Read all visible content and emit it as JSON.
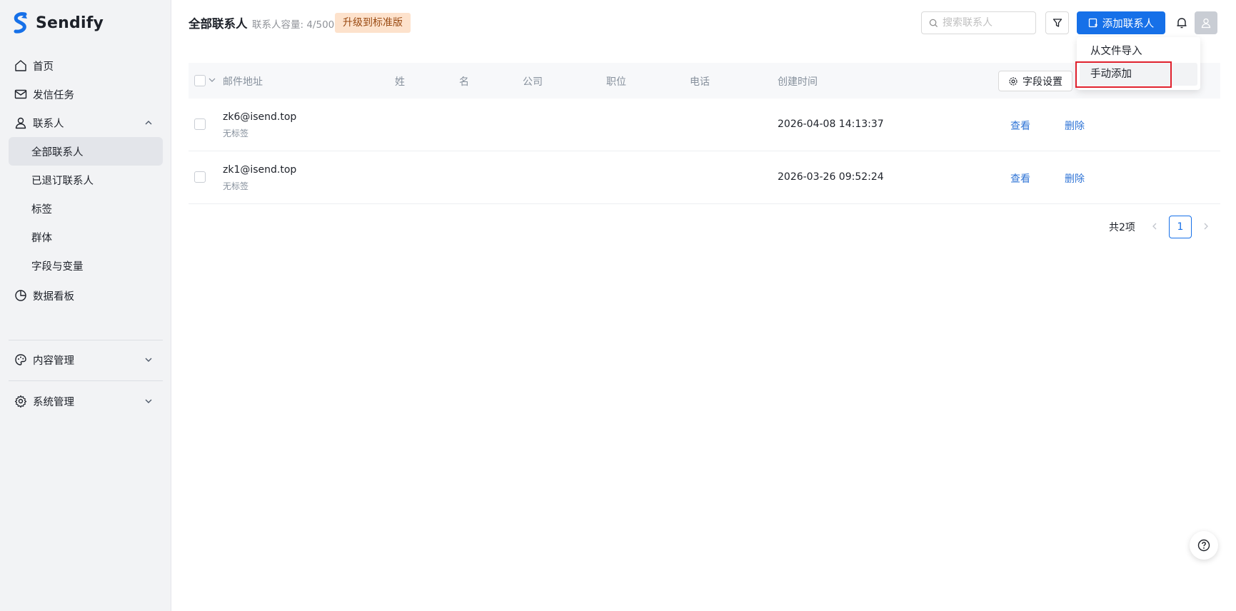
{
  "brand": {
    "name": "Sendify",
    "color": "#1670e8"
  },
  "sidebar": {
    "items": [
      {
        "label": "首页",
        "icon": "home-icon"
      },
      {
        "label": "发信任务",
        "icon": "mail-icon"
      },
      {
        "label": "联系人",
        "icon": "user-icon",
        "expanded": true
      },
      {
        "label": "数据看板",
        "icon": "pie-chart-icon"
      },
      {
        "label": "内容管理",
        "icon": "palette-icon",
        "expanded": false
      },
      {
        "label": "系统管理",
        "icon": "gear-icon",
        "expanded": false
      }
    ],
    "contacts_sub": [
      {
        "label": "全部联系人",
        "active": true
      },
      {
        "label": "已退订联系人"
      },
      {
        "label": "标签"
      },
      {
        "label": "群体"
      },
      {
        "label": "字段与变量"
      }
    ]
  },
  "header": {
    "title": "全部联系人",
    "capacity": "联系人容量: 4/500",
    "upgrade_label": "升级到标准版",
    "search_placeholder": "搜索联系人",
    "add_button_label": "添加联系人"
  },
  "dropdown": {
    "items": [
      "从文件导入",
      "手动添加"
    ],
    "highlighted": "手动添加"
  },
  "table": {
    "columns": [
      "邮件地址",
      "姓",
      "名",
      "公司",
      "职位",
      "电话",
      "创建时间"
    ],
    "field_settings_label": "字段设置",
    "rows": [
      {
        "email": "zk6@isend.top",
        "tags": "无标签",
        "created": "2026-04-08 14:13:37",
        "view": "查看",
        "delete": "删除"
      },
      {
        "email": "zk1@isend.top",
        "tags": "无标签",
        "created": "2026-03-26 09:52:24",
        "view": "查看",
        "delete": "删除"
      }
    ]
  },
  "pagination": {
    "total": "共2项",
    "current_page": "1"
  },
  "colors": {
    "primary": "#1670e8",
    "upgrade_bg": "#fde2cc",
    "highlight": "#e0212d",
    "link": "#2f74d6"
  }
}
